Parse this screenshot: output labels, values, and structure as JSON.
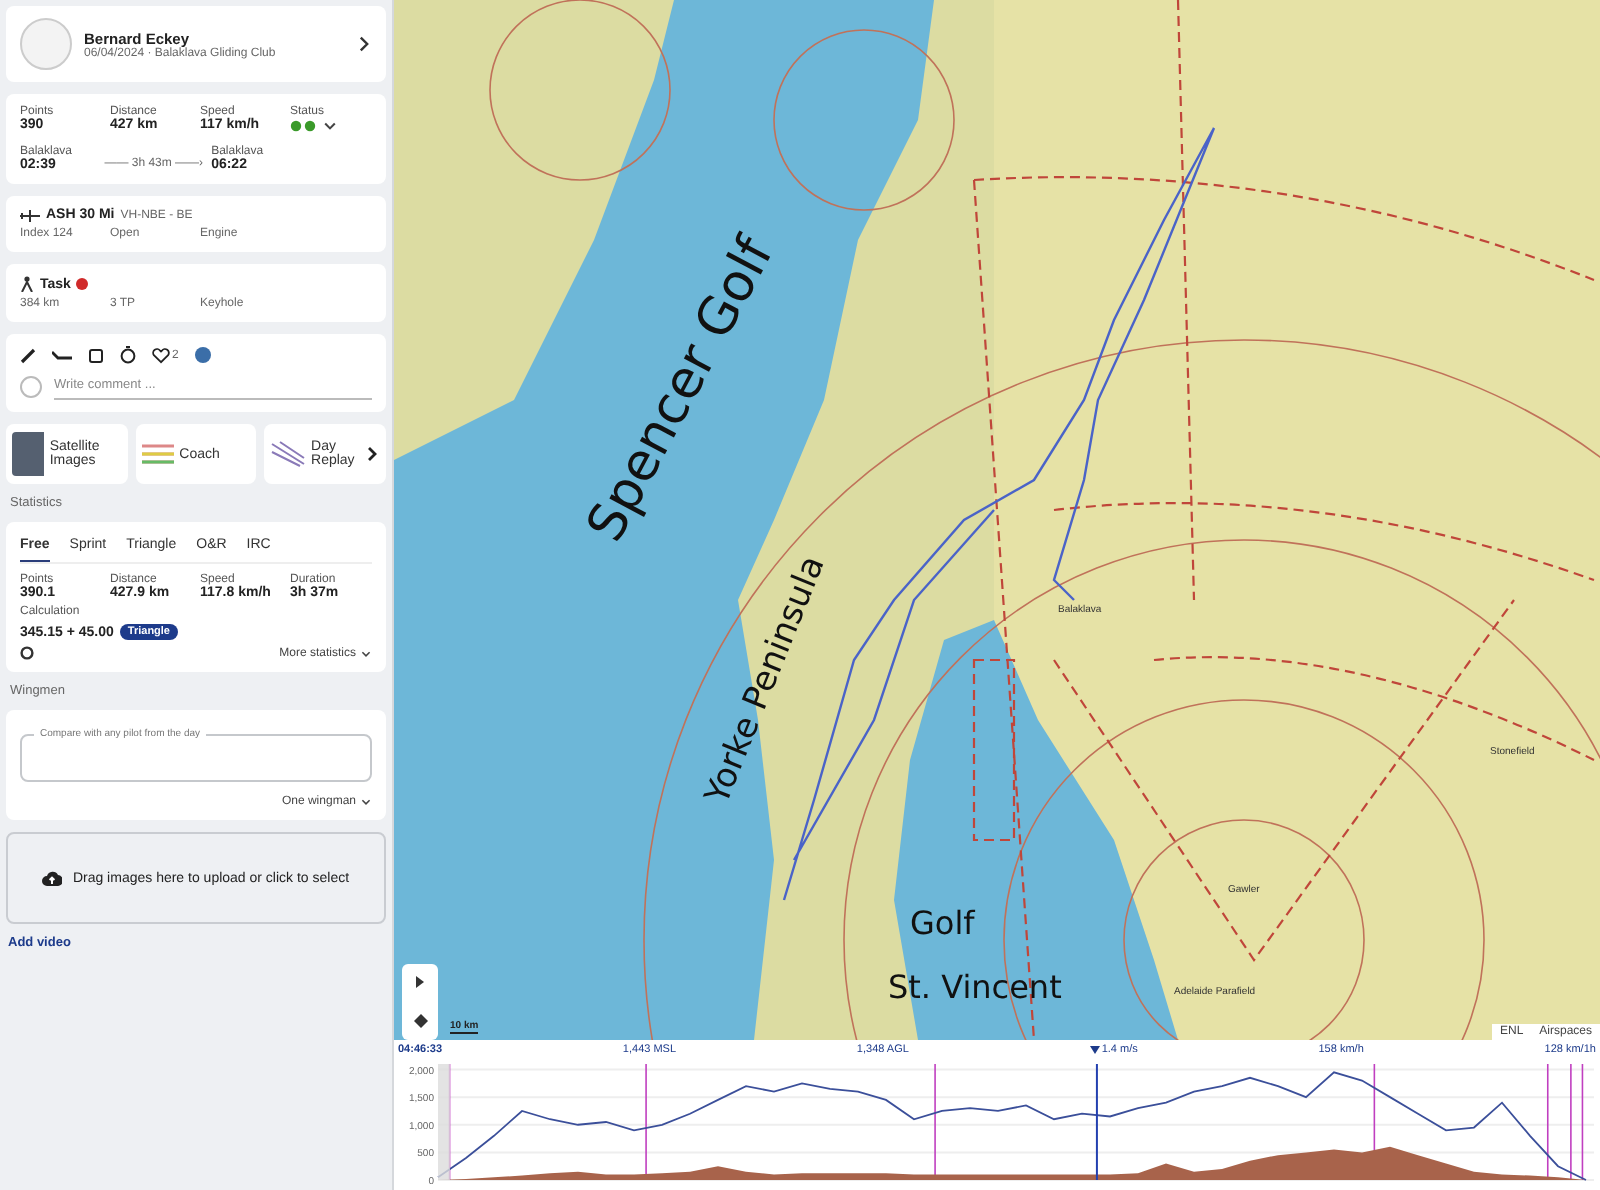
{
  "pilot": {
    "name": "Bernard Eckey",
    "subtitle": "06/04/2024 · Balaklava Gliding Club"
  },
  "flight_stats": [
    {
      "label": "Points",
      "value": "390"
    },
    {
      "label": "Distance",
      "value": "427 km"
    },
    {
      "label": "Speed",
      "value": "117 km/h"
    },
    {
      "label": "Status"
    }
  ],
  "takeoff": {
    "place": "Balaklava",
    "time": "02:39"
  },
  "duration": "—— 3h 43m ——›",
  "landing": {
    "place": "Balaklava",
    "time": "06:22"
  },
  "glider": {
    "model": "ASH 30 Mi",
    "registration": "VH-NBE  -  BE",
    "details": [
      "Index 124",
      "Open",
      "Engine"
    ]
  },
  "task": {
    "title": "Task",
    "details": [
      "384 km",
      "3 TP",
      "Keyhole"
    ]
  },
  "actions": {
    "likes": "2",
    "comment_placeholder": "Write comment ..."
  },
  "tools": [
    {
      "label": "Satellite Images",
      "kind": "photo"
    },
    {
      "label": "Coach",
      "kind": "coach"
    },
    {
      "label": "Day Replay",
      "kind": "replay"
    }
  ],
  "statistics": {
    "heading": "Statistics",
    "tabs": [
      {
        "label": "Free",
        "selected": true
      },
      {
        "label": "Sprint",
        "selected": false
      },
      {
        "label": "Triangle",
        "selected": false
      },
      {
        "label": "O&R",
        "selected": false
      },
      {
        "label": "IRC",
        "selected": false
      }
    ],
    "values": [
      {
        "label": "Points",
        "value": "390.1"
      },
      {
        "label": "Distance",
        "value": "427.9 km"
      },
      {
        "label": "Speed",
        "value": "117.8 km/h"
      },
      {
        "label": "Duration",
        "value": "3h 37m"
      }
    ],
    "calculation_label": "Calculation",
    "calculation": "345.15 + 45.00",
    "badge": "Triangle",
    "more": "More statistics"
  },
  "wingmen": {
    "heading": "Wingmen",
    "field_label": "Compare with any pilot from the day",
    "count": "One wingman"
  },
  "upload": "Drag images here to upload or click to select",
  "add_video": "Add video",
  "map": {
    "labels": [
      {
        "text": "Spencer Golf",
        "kind": "gulf"
      },
      {
        "text": "Yorke Peninsula",
        "kind": "peninsula"
      },
      {
        "text": "Golf",
        "kind": "gulf2"
      },
      {
        "text": "St. Vincent",
        "kind": "gulf3"
      }
    ],
    "places": [
      {
        "name": "Balaklava"
      },
      {
        "name": "Stonefield"
      },
      {
        "name": "Gawler"
      },
      {
        "name": "Adelaide Parafield"
      }
    ],
    "scale": "10 km",
    "layers": [
      {
        "label": "ENL",
        "selected": false
      },
      {
        "label": "Airspaces",
        "selected": false
      }
    ]
  },
  "chart": {
    "time": "04:46:33",
    "readings": [
      "1,443 MSL",
      "1,348 AGL",
      "1.4 m/s",
      "158 km/h",
      "128 km/1h"
    ],
    "chart_data": {
      "type": "line",
      "grid": true,
      "yticks": [
        {
          "value": 0,
          "label": "0"
        },
        {
          "value": 500,
          "label": "500"
        },
        {
          "value": 1000,
          "label": "1,000"
        },
        {
          "value": 1500,
          "label": "1,500"
        },
        {
          "value": 2000,
          "label": "2,000"
        }
      ],
      "ylim": [
        0,
        2100
      ],
      "series": [
        {
          "type": "line",
          "color": "#3b4f9a",
          "values": [
            50,
            400,
            800,
            1250,
            1100,
            1000,
            1050,
            900,
            1000,
            1200,
            1450,
            1700,
            1600,
            1750,
            1650,
            1600,
            1450,
            1100,
            1250,
            1300,
            1250,
            1350,
            1100,
            1200,
            1150,
            1300,
            1400,
            1600,
            1700,
            1850,
            1700,
            1500,
            1950,
            1800,
            1500,
            1200,
            900,
            950,
            1400,
            800,
            250,
            0
          ]
        },
        {
          "type": "area",
          "color": "#a8634b",
          "values": [
            0,
            20,
            50,
            80,
            120,
            150,
            100,
            100,
            120,
            150,
            250,
            150,
            100,
            120,
            120,
            120,
            120,
            100,
            100,
            100,
            100,
            100,
            100,
            100,
            100,
            120,
            300,
            150,
            200,
            350,
            450,
            500,
            550,
            500,
            600,
            450,
            300,
            150,
            100,
            80,
            50,
            0
          ]
        }
      ]
    }
  }
}
